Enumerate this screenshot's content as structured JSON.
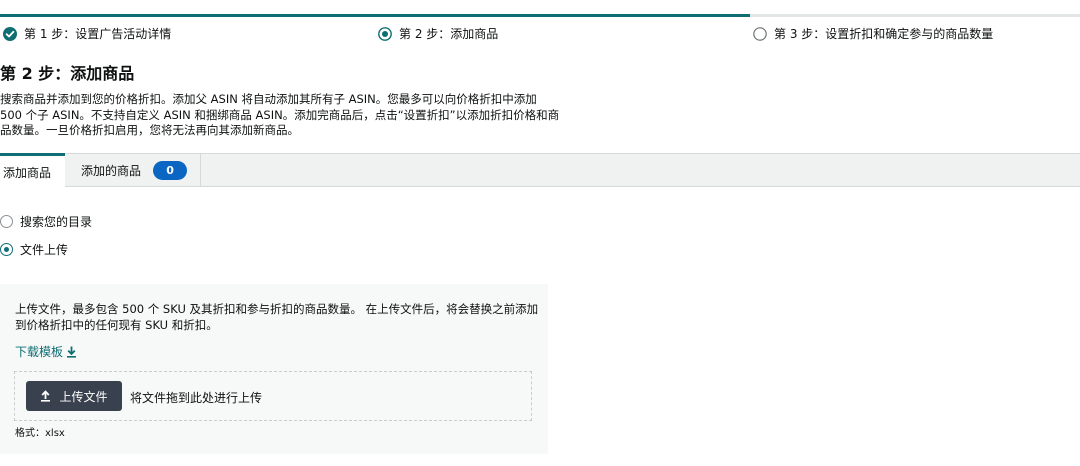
{
  "progress": {
    "percent": 69.4
  },
  "steps": [
    {
      "label": "第 1 步：设置广告活动详情",
      "state": "done"
    },
    {
      "label": "第 2 步：添加商品",
      "state": "current"
    },
    {
      "label": "第 3 步：设置折扣和确定参与的商品数量",
      "state": "pending"
    }
  ],
  "page": {
    "title": "第 2 步：添加商品",
    "description": "搜索商品并添加到您的价格折扣。添加父 ASIN 将自动添加其所有子 ASIN。您最多可以向价格折扣中添加 500 个子 ASIN。不支持自定义 ASIN 和捆绑商品 ASIN。添加完商品后，点击“设置折扣”以添加折扣价格和商品数量。一旦价格折扣启用，您将无法再向其添加新商品。"
  },
  "tabs": [
    {
      "label": "添加商品"
    },
    {
      "label": "添加的商品",
      "count": "0"
    }
  ],
  "options": [
    {
      "label": "搜索您的目录",
      "checked": false
    },
    {
      "label": "文件上传",
      "checked": true
    }
  ],
  "upload": {
    "instructions": "上传文件，最多包含 500 个 SKU 及其折扣和参与折扣的商品数量。 在上传文件后，将会替换之前添加到价格折扣中的任何现有 SKU 和折扣。",
    "download_label": "下载模板",
    "button_label": "上传文件",
    "drop_hint": "将文件拖到此处进行上传",
    "format": "格式：xlsx"
  },
  "colors": {
    "accent": "#0f6e73",
    "badge": "#0a66c2",
    "button": "#38414d"
  },
  "icons": {
    "step_done": "check-circle-icon",
    "step_current": "radio-checked-icon",
    "step_pending": "radio-empty-icon",
    "download": "download-icon",
    "upload": "upload-icon"
  }
}
